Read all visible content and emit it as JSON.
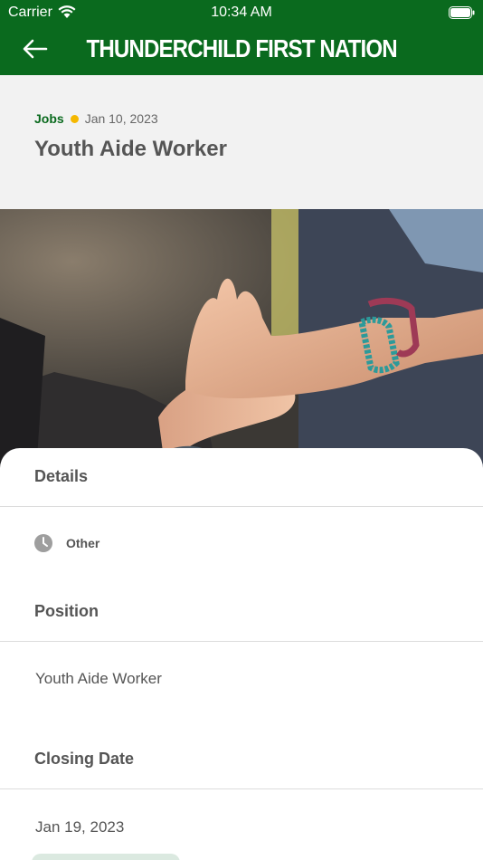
{
  "status_bar": {
    "carrier": "Carrier",
    "time": "10:34 AM"
  },
  "header": {
    "title": "THUNDERCHILD FIRST NATION",
    "back_icon": "arrow-left-icon"
  },
  "post": {
    "category": "Jobs",
    "date": "Jan 10, 2023",
    "title": "Youth Aide Worker"
  },
  "details": {
    "heading": "Details",
    "type_icon": "clock-icon",
    "type_label": "Other"
  },
  "position": {
    "heading": "Position",
    "value": "Youth Aide Worker"
  },
  "closing_date": {
    "heading": "Closing Date",
    "value": "Jan 19, 2023"
  },
  "colors": {
    "brand": "#0a6a1e",
    "accent_dot": "#f5b800"
  }
}
